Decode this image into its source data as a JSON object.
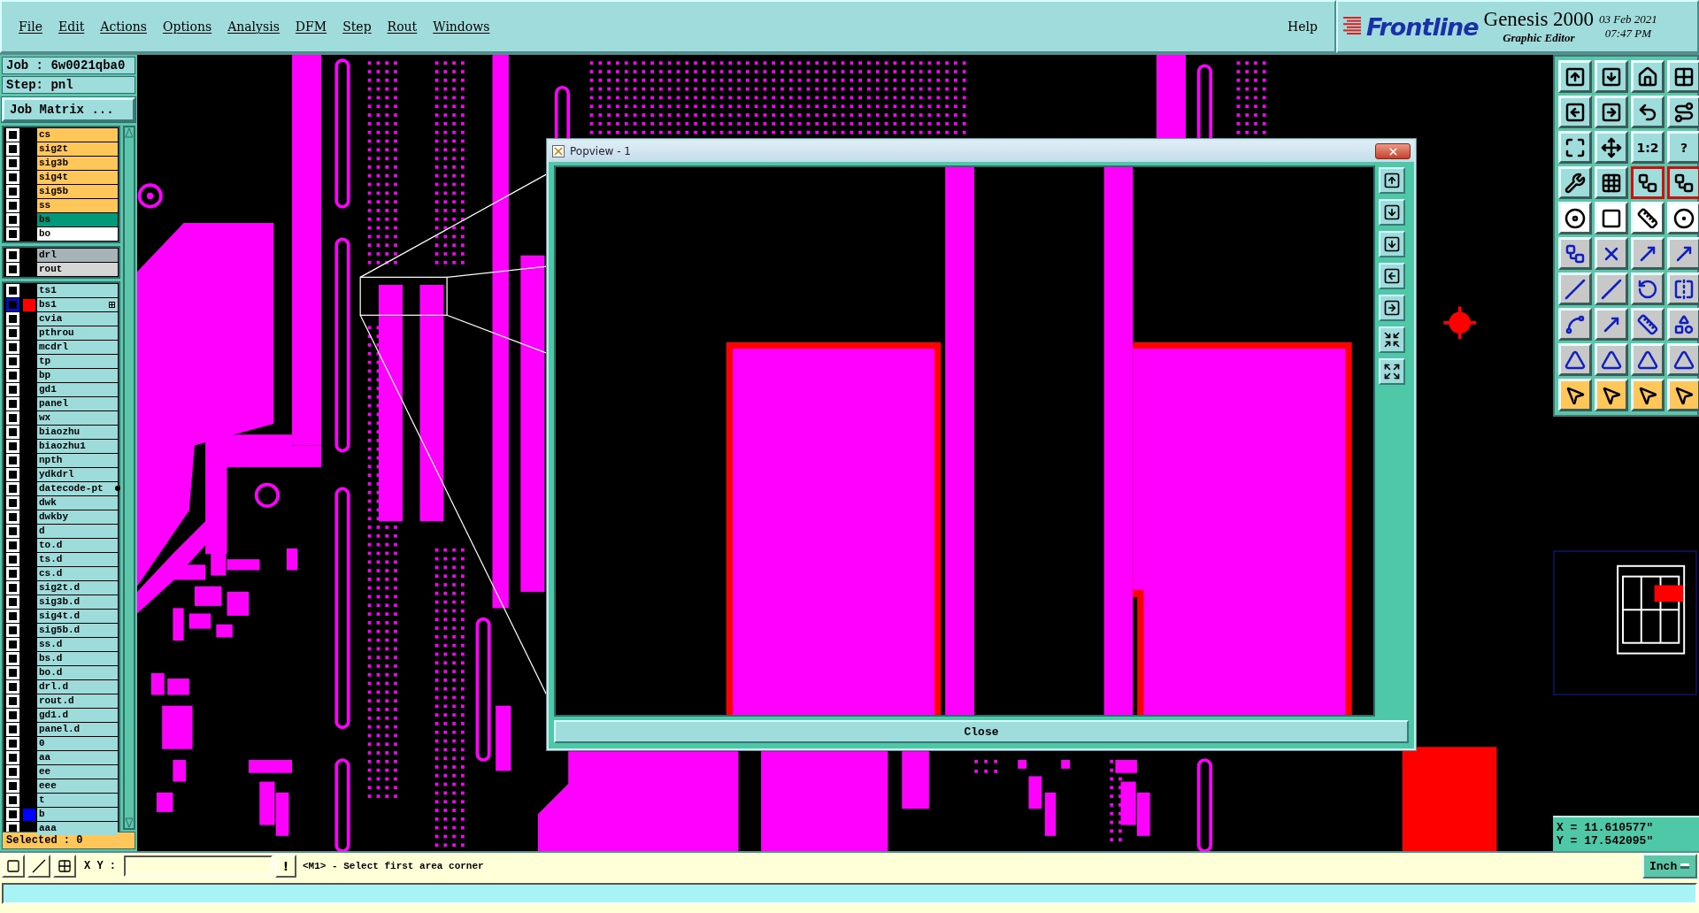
{
  "menu": [
    {
      "label": "File"
    },
    {
      "label": "Edit"
    },
    {
      "label": "Actions"
    },
    {
      "label": "Options"
    },
    {
      "label": "Analysis"
    },
    {
      "label": "DFM"
    },
    {
      "label": "Step"
    },
    {
      "label": "Rout"
    },
    {
      "label": "Windows"
    }
  ],
  "help": "Help",
  "brand": {
    "name": "Frontline",
    "product": "Genesis 2000",
    "subtitle": "Graphic Editor",
    "date": "03 Feb 2021",
    "time": "07:47 PM"
  },
  "job_line": "Job : 6w0021qba0",
  "step_line": "Step: pnl",
  "job_matrix_button": "Job Matrix ...",
  "layer_groups": [
    [
      {
        "name": "cs",
        "color": "#ffc65a",
        "checked": false,
        "focused": false,
        "flagged": false,
        "truncated": false
      },
      {
        "name": "sig2t",
        "color": "#ffc65a",
        "checked": false,
        "focused": false,
        "flagged": false,
        "truncated": false
      },
      {
        "name": "sig3b",
        "color": "#ffc65a",
        "checked": false,
        "focused": false,
        "flagged": false,
        "truncated": false
      },
      {
        "name": "sig4t",
        "color": "#ffc65a",
        "checked": false,
        "focused": false,
        "flagged": false,
        "truncated": false
      },
      {
        "name": "sig5b",
        "color": "#ffc65a",
        "checked": false,
        "focused": false,
        "flagged": false,
        "truncated": false
      },
      {
        "name": "ss",
        "color": "#ffc65a",
        "checked": false,
        "focused": false,
        "flagged": false,
        "truncated": false
      },
      {
        "name": "bs",
        "color": "#00997a",
        "checked": false,
        "focused": false,
        "flagged": false,
        "truncated": false
      },
      {
        "name": "bo",
        "color": "#ffffff",
        "checked": false,
        "focused": false,
        "flagged": false,
        "truncated": false
      }
    ],
    [
      {
        "name": "drl",
        "color": "#a6b4b8",
        "checked": false,
        "focused": false,
        "flagged": false,
        "truncated": false
      },
      {
        "name": "rout",
        "color": "#d6d6d6",
        "checked": false,
        "focused": false,
        "flagged": false,
        "truncated": false
      }
    ],
    [
      {
        "name": "ts1",
        "color": "#9edcdc",
        "checked": false,
        "focused": false,
        "flagged": false,
        "truncated": false
      },
      {
        "name": "bs1",
        "color": "#9edcdc",
        "swatch": {
          "color": "#ff0000"
        },
        "checked": false,
        "focused": true,
        "flagged": true,
        "truncated": false
      },
      {
        "name": "cvia",
        "color": "#9edcdc",
        "checked": false,
        "focused": false,
        "flagged": false,
        "truncated": false
      },
      {
        "name": "pthrou",
        "color": "#9edcdc",
        "checked": false,
        "focused": false,
        "flagged": false,
        "truncated": false
      },
      {
        "name": "mcdrl",
        "color": "#9edcdc",
        "checked": false,
        "focused": false,
        "flagged": false,
        "truncated": false
      },
      {
        "name": "tp",
        "color": "#9edcdc",
        "checked": false,
        "focused": false,
        "flagged": false,
        "truncated": false
      },
      {
        "name": "bp",
        "color": "#9edcdc",
        "checked": false,
        "focused": false,
        "flagged": false,
        "truncated": false
      },
      {
        "name": "gd1",
        "color": "#9edcdc",
        "checked": false,
        "focused": false,
        "flagged": false,
        "truncated": false
      },
      {
        "name": "panel",
        "color": "#9edcdc",
        "checked": false,
        "focused": false,
        "flagged": false,
        "truncated": false
      },
      {
        "name": "wx",
        "color": "#9edcdc",
        "checked": false,
        "focused": false,
        "flagged": false,
        "truncated": false
      },
      {
        "name": "biaozhu",
        "color": "#9edcdc",
        "checked": false,
        "focused": false,
        "flagged": false,
        "truncated": false
      },
      {
        "name": "biaozhu1",
        "color": "#9edcdc",
        "checked": false,
        "focused": false,
        "flagged": false,
        "truncated": false
      },
      {
        "name": "npth",
        "color": "#9edcdc",
        "checked": false,
        "focused": false,
        "flagged": false,
        "truncated": false
      },
      {
        "name": "ydkdrl",
        "color": "#9edcdc",
        "checked": false,
        "focused": false,
        "flagged": false,
        "truncated": false
      },
      {
        "name": "datecode-pt",
        "color": "#9edcdc",
        "checked": false,
        "focused": false,
        "flagged": false,
        "truncated": true
      },
      {
        "name": "dwk",
        "color": "#9edcdc",
        "checked": false,
        "focused": false,
        "flagged": false,
        "truncated": false
      },
      {
        "name": "dwkby",
        "color": "#9edcdc",
        "checked": false,
        "focused": false,
        "flagged": false,
        "truncated": false
      },
      {
        "name": "d",
        "color": "#9edcdc",
        "checked": false,
        "focused": false,
        "flagged": false,
        "truncated": false
      },
      {
        "name": "to.d",
        "color": "#9edcdc",
        "checked": false,
        "focused": false,
        "flagged": false,
        "truncated": false
      },
      {
        "name": "ts.d",
        "color": "#9edcdc",
        "checked": false,
        "focused": false,
        "flagged": false,
        "truncated": false
      },
      {
        "name": "cs.d",
        "color": "#9edcdc",
        "checked": false,
        "focused": false,
        "flagged": false,
        "truncated": false
      },
      {
        "name": "sig2t.d",
        "color": "#9edcdc",
        "checked": false,
        "focused": false,
        "flagged": false,
        "truncated": false
      },
      {
        "name": "sig3b.d",
        "color": "#9edcdc",
        "checked": false,
        "focused": false,
        "flagged": false,
        "truncated": false
      },
      {
        "name": "sig4t.d",
        "color": "#9edcdc",
        "checked": false,
        "focused": false,
        "flagged": false,
        "truncated": false
      },
      {
        "name": "sig5b.d",
        "color": "#9edcdc",
        "checked": false,
        "focused": false,
        "flagged": false,
        "truncated": false
      },
      {
        "name": "ss.d",
        "color": "#9edcdc",
        "checked": false,
        "focused": false,
        "flagged": false,
        "truncated": false
      },
      {
        "name": "bs.d",
        "color": "#9edcdc",
        "checked": false,
        "focused": false,
        "flagged": false,
        "truncated": false
      },
      {
        "name": "bo.d",
        "color": "#9edcdc",
        "checked": false,
        "focused": false,
        "flagged": false,
        "truncated": false
      },
      {
        "name": "drl.d",
        "color": "#9edcdc",
        "checked": false,
        "focused": false,
        "flagged": false,
        "truncated": false
      },
      {
        "name": "rout.d",
        "color": "#9edcdc",
        "checked": false,
        "focused": false,
        "flagged": false,
        "truncated": false
      },
      {
        "name": "gd1.d",
        "color": "#9edcdc",
        "checked": false,
        "focused": false,
        "flagged": false,
        "truncated": false
      },
      {
        "name": "panel.d",
        "color": "#9edcdc",
        "checked": false,
        "focused": false,
        "flagged": false,
        "truncated": false
      },
      {
        "name": "0",
        "color": "#9edcdc",
        "checked": false,
        "focused": false,
        "flagged": false,
        "truncated": false
      },
      {
        "name": "aa",
        "color": "#9edcdc",
        "checked": false,
        "focused": false,
        "flagged": false,
        "truncated": false
      },
      {
        "name": "ee",
        "color": "#9edcdc",
        "checked": false,
        "focused": false,
        "flagged": false,
        "truncated": false
      },
      {
        "name": "eee",
        "color": "#9edcdc",
        "checked": false,
        "focused": false,
        "flagged": false,
        "truncated": false
      },
      {
        "name": "t",
        "color": "#9edcdc",
        "checked": false,
        "focused": false,
        "flagged": false,
        "truncated": false
      },
      {
        "name": "b",
        "color": "#9edcdc",
        "swatch": {
          "color": "#0000ff"
        },
        "checked": false,
        "focused": false,
        "flagged": false,
        "truncated": false
      },
      {
        "name": "aaa",
        "color": "#9edcdc",
        "checked": false,
        "focused": false,
        "flagged": false,
        "truncated": false
      }
    ]
  ],
  "selected_count": "Selected : 0",
  "toolbar": [
    {
      "kind": "teal"
    },
    {
      "kind": "teal"
    },
    {
      "kind": "teal"
    },
    {
      "kind": "teal"
    },
    {
      "kind": "teal"
    },
    {
      "kind": "teal"
    },
    {
      "kind": "teal"
    },
    {
      "kind": "teal"
    },
    {
      "kind": "teal"
    },
    {
      "kind": "teal"
    },
    {
      "kind": "teal",
      "label": "1:2"
    },
    {
      "kind": "teal",
      "label": "?"
    },
    {
      "kind": "teal"
    },
    {
      "kind": "teal"
    },
    {
      "kind": "teal",
      "on": true
    },
    {
      "kind": "teal",
      "on": true
    },
    {
      "kind": "white"
    },
    {
      "kind": "white"
    },
    {
      "kind": "white"
    },
    {
      "kind": "white"
    },
    {
      "kind": "grey"
    },
    {
      "kind": "grey"
    },
    {
      "kind": "grey"
    },
    {
      "kind": "grey"
    },
    {
      "kind": "grey"
    },
    {
      "kind": "grey"
    },
    {
      "kind": "grey"
    },
    {
      "kind": "grey"
    },
    {
      "kind": "grey"
    },
    {
      "kind": "grey"
    },
    {
      "kind": "grey"
    },
    {
      "kind": "grey"
    },
    {
      "kind": "grey"
    },
    {
      "kind": "grey"
    },
    {
      "kind": "grey"
    },
    {
      "kind": "grey"
    },
    {
      "kind": "orange"
    },
    {
      "kind": "orange"
    },
    {
      "kind": "orange"
    },
    {
      "kind": "orange"
    }
  ],
  "popview": {
    "title": "Popview - 1",
    "close_button": "Close"
  },
  "coordinates": [
    "X = 11.610577\"",
    "Y = 17.542095\""
  ],
  "command_bar": {
    "xy_label": "X Y :",
    "alert_button": "!",
    "prompt": "<M1> - Select first area corner",
    "units": "Inch"
  }
}
